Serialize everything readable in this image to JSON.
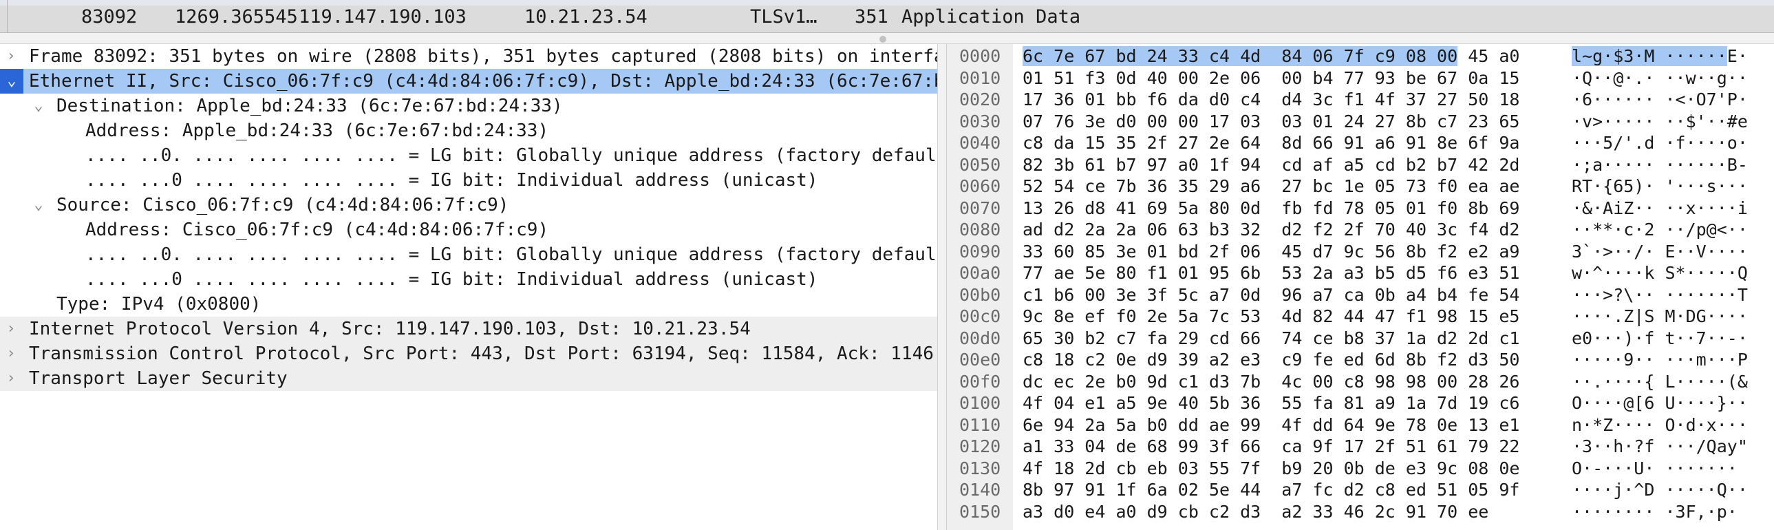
{
  "packet_row": {
    "number": "83092",
    "time": "1269.365545",
    "source": "119.147.190.103",
    "destination": "10.21.23.54",
    "protocol": "TLSv1…",
    "length": "351",
    "info": "Application Data"
  },
  "tree": [
    {
      "label": "Frame 83092: 351 bytes on wire (2808 bits), 351 bytes captured (2808 bits) on interfa",
      "level": 0,
      "state": "collapsed",
      "style": "plain"
    },
    {
      "label": "Ethernet II, Src: Cisco_06:7f:c9 (c4:4d:84:06:7f:c9), Dst: Apple_bd:24:33 (6c:7e:67:b",
      "level": 0,
      "state": "expanded-selected",
      "style": "selected"
    },
    {
      "label": "Destination: Apple_bd:24:33 (6c:7e:67:bd:24:33)",
      "level": 1,
      "state": "expanded",
      "style": "plain"
    },
    {
      "label": "Address: Apple_bd:24:33 (6c:7e:67:bd:24:33)",
      "level": 2,
      "state": "leaf",
      "style": "plain"
    },
    {
      "label": ".... ..0. .... .... .... .... = LG bit: Globally unique address (factory defaul",
      "level": 2,
      "state": "leaf",
      "style": "plain"
    },
    {
      "label": ".... ...0 .... .... .... .... = IG bit: Individual address (unicast)",
      "level": 2,
      "state": "leaf",
      "style": "plain"
    },
    {
      "label": "Source: Cisco_06:7f:c9 (c4:4d:84:06:7f:c9)",
      "level": 1,
      "state": "expanded",
      "style": "plain"
    },
    {
      "label": "Address: Cisco_06:7f:c9 (c4:4d:84:06:7f:c9)",
      "level": 2,
      "state": "leaf",
      "style": "plain"
    },
    {
      "label": ".... ..0. .... .... .... .... = LG bit: Globally unique address (factory defaul",
      "level": 2,
      "state": "leaf",
      "style": "plain"
    },
    {
      "label": ".... ...0 .... .... .... .... = IG bit: Individual address (unicast)",
      "level": 2,
      "state": "leaf",
      "style": "plain"
    },
    {
      "label": "Type: IPv4 (0x0800)",
      "level": 1,
      "state": "leaf",
      "style": "plain"
    },
    {
      "label": "Internet Protocol Version 4, Src: 119.147.190.103, Dst: 10.21.23.54",
      "level": 0,
      "state": "collapsed",
      "style": "shaded"
    },
    {
      "label": "Transmission Control Protocol, Src Port: 443, Dst Port: 63194, Seq: 11584, Ack: 1146",
      "level": 0,
      "state": "collapsed",
      "style": "shaded"
    },
    {
      "label": "Transport Layer Security",
      "level": 0,
      "state": "collapsed",
      "style": "shaded"
    }
  ],
  "hex_dump": [
    {
      "offset": "0000",
      "bytes_hl": "6c 7e 67 bd 24 33 c4 4d  84 06 7f c9 08 00",
      "bytes": " 45 a0",
      "ascii_hl": "l~g·$3·M ······",
      "ascii": "E·"
    },
    {
      "offset": "0010",
      "bytes_hl": "",
      "bytes": "01 51 f3 0d 40 00 2e 06  00 b4 77 93 be 67 0a 15",
      "ascii_hl": "",
      "ascii": "·Q··@·.· ··w··g··"
    },
    {
      "offset": "0020",
      "bytes_hl": "",
      "bytes": "17 36 01 bb f6 da d0 c4  d4 3c f1 4f 37 27 50 18",
      "ascii_hl": "",
      "ascii": "·6······ ·<·O7'P·"
    },
    {
      "offset": "0030",
      "bytes_hl": "",
      "bytes": "07 76 3e d0 00 00 17 03  03 01 24 27 8b c7 23 65",
      "ascii_hl": "",
      "ascii": "·v>····· ··$'··#e"
    },
    {
      "offset": "0040",
      "bytes_hl": "",
      "bytes": "c8 da 15 35 2f 27 2e 64  8d 66 91 a6 91 8e 6f 9a",
      "ascii_hl": "",
      "ascii": "···5/'.d ·f····o·"
    },
    {
      "offset": "0050",
      "bytes_hl": "",
      "bytes": "82 3b 61 b7 97 a0 1f 94  cd af a5 cd b2 b7 42 2d",
      "ascii_hl": "",
      "ascii": "·;a····· ······B-"
    },
    {
      "offset": "0060",
      "bytes_hl": "",
      "bytes": "52 54 ce 7b 36 35 29 a6  27 bc 1e 05 73 f0 ea ae",
      "ascii_hl": "",
      "ascii": "RT·{65)· '···s···"
    },
    {
      "offset": "0070",
      "bytes_hl": "",
      "bytes": "13 26 d8 41 69 5a 80 0d  fb fd 78 05 01 f0 8b 69",
      "ascii_hl": "",
      "ascii": "·&·AiZ·· ··x····i"
    },
    {
      "offset": "0080",
      "bytes_hl": "",
      "bytes": "ad d2 2a 2a 06 63 b3 32  d2 f2 2f 70 40 3c f4 d2",
      "ascii_hl": "",
      "ascii": "··**·c·2 ··/p@<··"
    },
    {
      "offset": "0090",
      "bytes_hl": "",
      "bytes": "33 60 85 3e 01 bd 2f 06  45 d7 9c 56 8b f2 e2 a9",
      "ascii_hl": "",
      "ascii": "3`·>··/· E··V····"
    },
    {
      "offset": "00a0",
      "bytes_hl": "",
      "bytes": "77 ae 5e 80 f1 01 95 6b  53 2a a3 b5 d5 f6 e3 51",
      "ascii_hl": "",
      "ascii": "w·^····k S*·····Q"
    },
    {
      "offset": "00b0",
      "bytes_hl": "",
      "bytes": "c1 b6 00 3e 3f 5c a7 0d  96 a7 ca 0b a4 b4 fe 54",
      "ascii_hl": "",
      "ascii": "···>?\\·· ·······T"
    },
    {
      "offset": "00c0",
      "bytes_hl": "",
      "bytes": "9c 8e ef f0 2e 5a 7c 53  4d 82 44 47 f1 98 15 e5",
      "ascii_hl": "",
      "ascii": "····.Z|S M·DG····"
    },
    {
      "offset": "00d0",
      "bytes_hl": "",
      "bytes": "65 30 b2 c7 fa 29 cd 66  74 ce b8 37 1a d2 2d c1",
      "ascii_hl": "",
      "ascii": "e0···)·f t··7··-·"
    },
    {
      "offset": "00e0",
      "bytes_hl": "",
      "bytes": "c8 18 c2 0e d9 39 a2 e3  c9 fe ed 6d 8b f2 d3 50",
      "ascii_hl": "",
      "ascii": "·····9·· ···m···P"
    },
    {
      "offset": "00f0",
      "bytes_hl": "",
      "bytes": "dc ec 2e b0 9d c1 d3 7b  4c 00 c8 98 98 00 28 26",
      "ascii_hl": "",
      "ascii": "··.····{ L·····(&"
    },
    {
      "offset": "0100",
      "bytes_hl": "",
      "bytes": "4f 04 e1 a5 9e 40 5b 36  55 fa 81 a9 1a 7d 19 c6",
      "ascii_hl": "",
      "ascii": "O····@[6 U····}··"
    },
    {
      "offset": "0110",
      "bytes_hl": "",
      "bytes": "6e 94 2a 5a b0 dd ae 99  4f dd 64 9e 78 0e 13 e1",
      "ascii_hl": "",
      "ascii": "n·*Z···· O·d·x···"
    },
    {
      "offset": "0120",
      "bytes_hl": "",
      "bytes": "a1 33 04 de 68 99 3f 66  ca 9f 17 2f 51 61 79 22",
      "ascii_hl": "",
      "ascii": "·3··h·?f ···/Qay\""
    },
    {
      "offset": "0130",
      "bytes_hl": "",
      "bytes": "4f 18 2d cb eb 03 55 7f  b9 20 0b de e3 9c 08 0e",
      "ascii_hl": "",
      "ascii": "O·-···U· ·······"
    },
    {
      "offset": "0140",
      "bytes_hl": "",
      "bytes": "8b 97 91 1f 6a 02 5e 44  a7 fc d2 c8 ed 51 05 9f",
      "ascii_hl": "",
      "ascii": "····j·^D ·····Q··"
    },
    {
      "offset": "0150",
      "bytes_hl": "",
      "bytes": "a3 d0 e4 a0 d9 cb c2 d3  a2 33 46 2c 91 70 ee",
      "ascii_hl": "",
      "ascii": "········ ·3F,·p·"
    }
  ],
  "icons": {
    "collapsed": "chevron-right-icon",
    "expanded": "chevron-down-icon"
  },
  "colors": {
    "selection": "#a6c8f5",
    "selected_arrow_bg": "#2b66d9",
    "shaded_row": "#eeeeee",
    "packet_row_bg": "#dcdcdc"
  }
}
